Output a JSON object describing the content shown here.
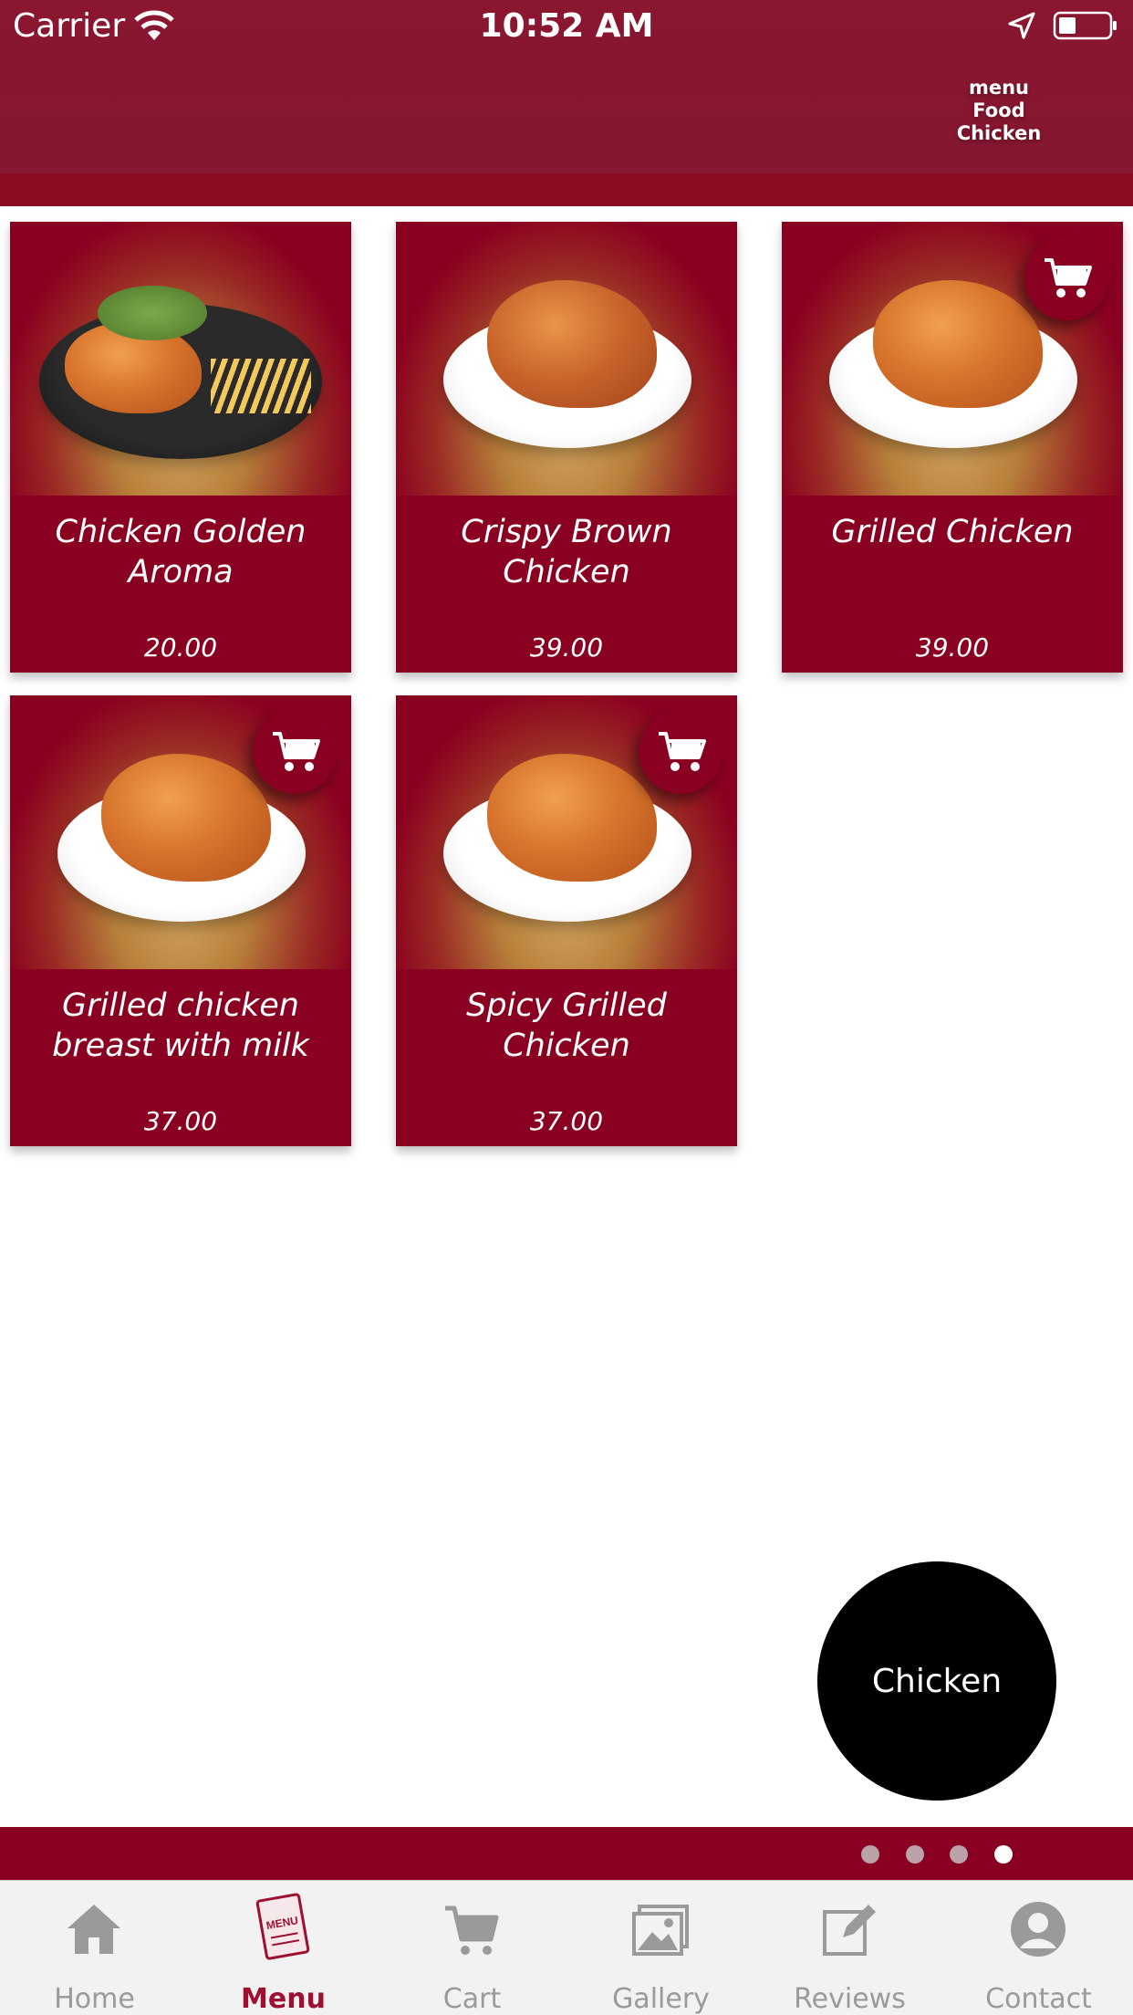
{
  "status_bar": {
    "carrier": "Carrier",
    "time": "10:52 AM"
  },
  "header": {
    "breadcrumb": [
      "menu",
      "Food",
      "Chicken"
    ]
  },
  "products": [
    {
      "name": "Chicken Golden Aroma",
      "price": "20.00",
      "has_cart_badge": false
    },
    {
      "name": "Crispy Brown Chicken",
      "price": "39.00",
      "has_cart_badge": false
    },
    {
      "name": "Grilled Chicken",
      "price": "39.00",
      "has_cart_badge": true
    },
    {
      "name": "Grilled chicken breast with milk",
      "price": "37.00",
      "has_cart_badge": true
    },
    {
      "name": "Spicy Grilled Chicken",
      "price": "37.00",
      "has_cart_badge": true
    }
  ],
  "category_button": {
    "label": "Chicken"
  },
  "pager": {
    "count": 4,
    "active_index": 3
  },
  "tabs": [
    {
      "label": "Home",
      "icon": "home-icon",
      "active": false
    },
    {
      "label": "Menu",
      "icon": "menu-book-icon",
      "active": true
    },
    {
      "label": "Cart",
      "icon": "cart-icon",
      "active": false
    },
    {
      "label": "Gallery",
      "icon": "gallery-icon",
      "active": false
    },
    {
      "label": "Reviews",
      "icon": "edit-icon",
      "active": false
    },
    {
      "label": "Contact",
      "icon": "user-icon",
      "active": false
    }
  ],
  "colors": {
    "brand": "#8a0020",
    "active_tab": "#9e1030",
    "inactive_tab": "#9a9a9a"
  }
}
